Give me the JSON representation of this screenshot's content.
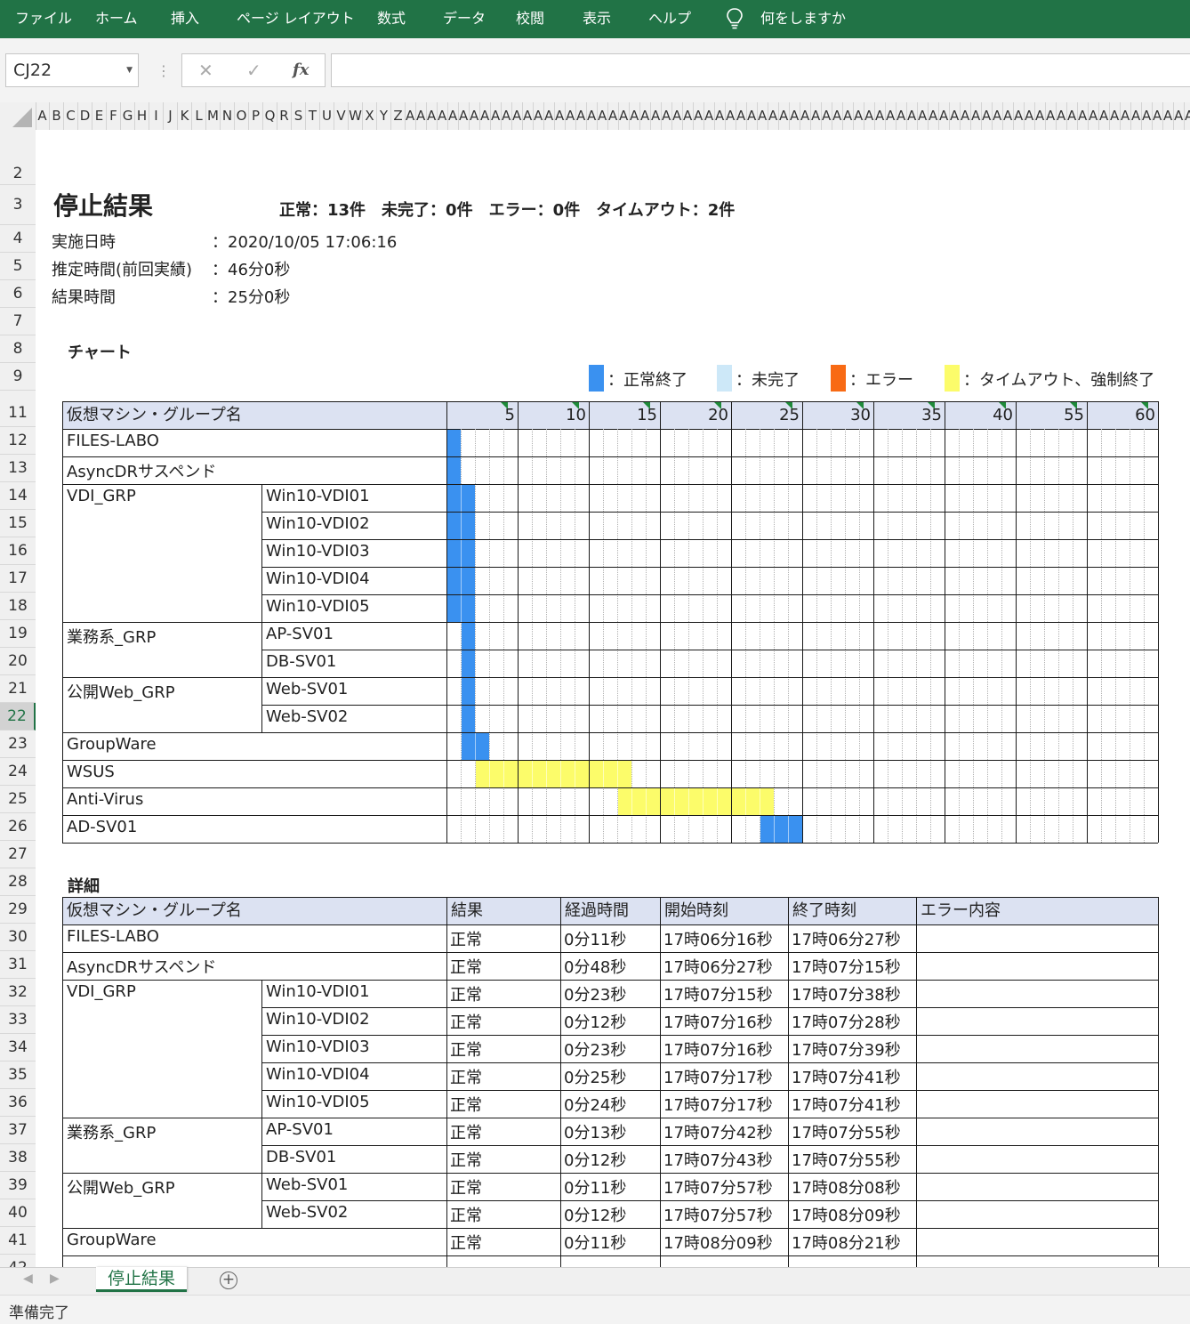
{
  "ribbon": {
    "menu": [
      "ファイル",
      "ホーム",
      "挿入",
      "ページ レイアウト",
      "数式",
      "データ",
      "校閲",
      "表示",
      "ヘルプ"
    ],
    "tellme": "何をしますか",
    "bg": "#217346"
  },
  "formula_bar": {
    "name_box": "CJ22",
    "cancel": "✕",
    "enter": "✓",
    "fx": "fx",
    "value": ""
  },
  "columns": [
    "A",
    "B",
    "C",
    "D",
    "E",
    "F",
    "G",
    "H",
    "I",
    "J",
    "K",
    "L",
    "M",
    "N",
    "O",
    "P",
    "Q",
    "R",
    "S",
    "T",
    "U",
    "V",
    "W",
    "X",
    "Y",
    "Z",
    "AA",
    "AA",
    "AA",
    "AA",
    "AA",
    "AA",
    "AA",
    "AA",
    "AA",
    "AA",
    "AA",
    "AA",
    "AA",
    "AA",
    "AA",
    "AA",
    "AA",
    "AA",
    "AA",
    "AA",
    "AA",
    "AA",
    "AA",
    "AA",
    "AA",
    "AA",
    "AA",
    "AA",
    "AA",
    "AA",
    "AA",
    "AA",
    "AA",
    "AA",
    "AA",
    "AA",
    "AA",
    "AA",
    "AA",
    "AA",
    "AA",
    "AA",
    "AA",
    "AA",
    "AA",
    "AA",
    "AA",
    "AA",
    "AA",
    "AA",
    "AA",
    "AA",
    "AA",
    "AA",
    "AA",
    "AA",
    "AA",
    "AA",
    "AA",
    "AA",
    "AA",
    "AA",
    "AA",
    "AA",
    "AA",
    "AA",
    "AA",
    "AA",
    "AA",
    "AA",
    "AA",
    "AA",
    "AA",
    "AA",
    "AA",
    "AA",
    "AA",
    "AA",
    "AA",
    "AA",
    "AA",
    "AA",
    "AA",
    "AA",
    "AA",
    "AA",
    "AA",
    "AA",
    "AA",
    "AA",
    "AA",
    "AA",
    "AA",
    "AA",
    "AA",
    "AA",
    "AA",
    "AA",
    "AA",
    "AA",
    "AA"
  ],
  "rows": [
    "2",
    "3",
    "4",
    "5",
    "6",
    "7",
    "8",
    "9",
    "11",
    "12",
    "13",
    "14",
    "15",
    "16",
    "17",
    "18",
    "19",
    "20",
    "21",
    "22",
    "23",
    "24",
    "25",
    "26",
    "27",
    "28",
    "29",
    "30",
    "31",
    "32",
    "33",
    "34",
    "35",
    "36",
    "37",
    "38",
    "39",
    "40",
    "41",
    "42"
  ],
  "selected_row": "22",
  "sheet": {
    "title": "停止結果",
    "summary": "正常：13件　未完了：0件　エラー：0件　タイムアウト：2件",
    "info": [
      {
        "label": "実施日時",
        "value": "：2020/10/05 17:06:16"
      },
      {
        "label": "推定時間(前回実績)",
        "value": "：46分0秒"
      },
      {
        "label": "結果時間",
        "value": "：25分0秒"
      }
    ],
    "chart_heading": "チャート",
    "legend": [
      {
        "color": "#3a91f0",
        "label": "：正常終了"
      },
      {
        "color": "#cde8f8",
        "label": "：未完了"
      },
      {
        "color": "#f86a14",
        "label": "：エラー"
      },
      {
        "color": "#fcfc6a",
        "label": "：タイムアウト、強制終了"
      }
    ],
    "detail_heading": "詳細",
    "detail_headers": [
      "仮想マシン・グループ名",
      "結果",
      "経過時間",
      "開始時刻",
      "終了時刻",
      "エラー内容"
    ]
  },
  "chart_data": {
    "type": "table",
    "header": "仮想マシン・グループ名",
    "time_labels": [
      "5",
      "10",
      "15",
      "20",
      "25",
      "30",
      "35",
      "40",
      "55",
      "60"
    ],
    "rows": [
      {
        "group": "FILES-LABO",
        "vm": "",
        "status": "normal",
        "start": 0,
        "end": 1
      },
      {
        "group": "AsyncDRサスペンド",
        "vm": "",
        "status": "normal",
        "start": 0,
        "end": 1
      },
      {
        "group": "VDI_GRP",
        "vm": "Win10-VDI01",
        "status": "normal",
        "start": 0,
        "end": 2
      },
      {
        "group": "",
        "vm": "Win10-VDI02",
        "status": "normal",
        "start": 0,
        "end": 2
      },
      {
        "group": "",
        "vm": "Win10-VDI03",
        "status": "normal",
        "start": 0,
        "end": 2
      },
      {
        "group": "",
        "vm": "Win10-VDI04",
        "status": "normal",
        "start": 0,
        "end": 2
      },
      {
        "group": "",
        "vm": "Win10-VDI05",
        "status": "normal",
        "start": 0,
        "end": 2
      },
      {
        "group": "業務系_GRP",
        "vm": "AP-SV01",
        "status": "normal",
        "start": 1,
        "end": 2
      },
      {
        "group": "",
        "vm": "DB-SV01",
        "status": "normal",
        "start": 1,
        "end": 2
      },
      {
        "group": "公開Web_GRP",
        "vm": "Web-SV01",
        "status": "normal",
        "start": 1,
        "end": 2
      },
      {
        "group": "",
        "vm": "Web-SV02",
        "status": "normal",
        "start": 1,
        "end": 2
      },
      {
        "group": "GroupWare",
        "vm": "",
        "status": "normal",
        "start": 1,
        "end": 3
      },
      {
        "group": "WSUS",
        "vm": "",
        "status": "timeout",
        "start": 2,
        "end": 13
      },
      {
        "group": "Anti-Virus",
        "vm": "",
        "status": "timeout",
        "start": 12,
        "end": 23
      },
      {
        "group": "AD-SV01",
        "vm": "",
        "status": "normal",
        "start": 22,
        "end": 25
      }
    ],
    "detail": [
      {
        "group": "FILES-LABO",
        "vm": "",
        "result": "正常",
        "elapsed": "0分11秒",
        "start": "17時06分16秒",
        "end": "17時06分27秒",
        "error": ""
      },
      {
        "group": "AsyncDRサスペンド",
        "vm": "",
        "result": "正常",
        "elapsed": "0分48秒",
        "start": "17時06分27秒",
        "end": "17時07分15秒",
        "error": ""
      },
      {
        "group": "VDI_GRP",
        "vm": "Win10-VDI01",
        "result": "正常",
        "elapsed": "0分23秒",
        "start": "17時07分15秒",
        "end": "17時07分38秒",
        "error": ""
      },
      {
        "group": "",
        "vm": "Win10-VDI02",
        "result": "正常",
        "elapsed": "0分12秒",
        "start": "17時07分16秒",
        "end": "17時07分28秒",
        "error": ""
      },
      {
        "group": "",
        "vm": "Win10-VDI03",
        "result": "正常",
        "elapsed": "0分23秒",
        "start": "17時07分16秒",
        "end": "17時07分39秒",
        "error": ""
      },
      {
        "group": "",
        "vm": "Win10-VDI04",
        "result": "正常",
        "elapsed": "0分25秒",
        "start": "17時07分17秒",
        "end": "17時07分41秒",
        "error": ""
      },
      {
        "group": "",
        "vm": "Win10-VDI05",
        "result": "正常",
        "elapsed": "0分24秒",
        "start": "17時07分17秒",
        "end": "17時07分41秒",
        "error": ""
      },
      {
        "group": "業務系_GRP",
        "vm": "AP-SV01",
        "result": "正常",
        "elapsed": "0分13秒",
        "start": "17時07分42秒",
        "end": "17時07分55秒",
        "error": ""
      },
      {
        "group": "",
        "vm": "DB-SV01",
        "result": "正常",
        "elapsed": "0分12秒",
        "start": "17時07分43秒",
        "end": "17時07分55秒",
        "error": ""
      },
      {
        "group": "公開Web_GRP",
        "vm": "Web-SV01",
        "result": "正常",
        "elapsed": "0分11秒",
        "start": "17時07分57秒",
        "end": "17時08分08秒",
        "error": ""
      },
      {
        "group": "",
        "vm": "Web-SV02",
        "result": "正常",
        "elapsed": "0分12秒",
        "start": "17時07分57秒",
        "end": "17時08分09秒",
        "error": ""
      },
      {
        "group": "GroupWare",
        "vm": "",
        "result": "正常",
        "elapsed": "0分11秒",
        "start": "17時08分09秒",
        "end": "17時08分21秒",
        "error": ""
      }
    ]
  },
  "sheet_tab": "停止結果",
  "add_sheet": "+",
  "status": "準備完了"
}
